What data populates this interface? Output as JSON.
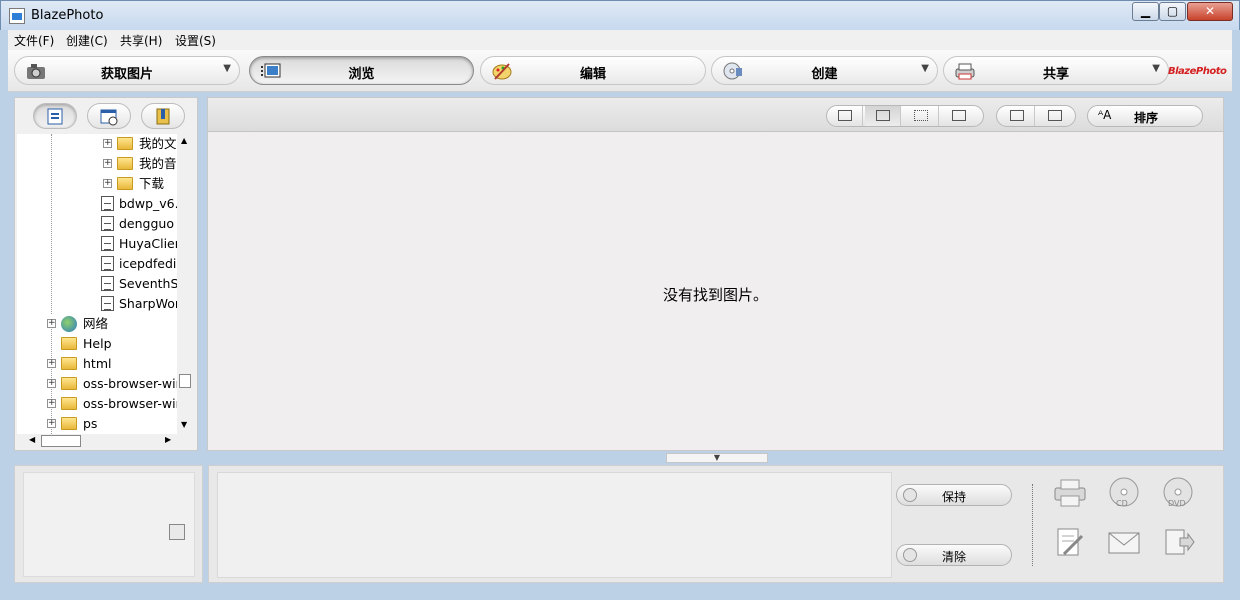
{
  "window": {
    "title": "BlazePhoto",
    "min_label": "0",
    "max_label": "1",
    "close_label": "r"
  },
  "menu": [
    "文件(F)",
    "创建(C)",
    "共享(H)",
    "设置(S)"
  ],
  "toolbar": {
    "acquire": "获取图片",
    "browse": "浏览",
    "edit": "编辑",
    "create": "创建",
    "share": "共享",
    "brand": "BlazePhoto"
  },
  "tree": {
    "items": [
      "我的文",
      "我的音",
      "下载",
      "bdwp_v6.",
      "dengguo",
      "HuyaClien",
      "icepdfedi",
      "SeventhS",
      "SharpWor",
      "网络",
      "Help",
      "html",
      "oss-browser-wir",
      "oss-browser-wir",
      "ps"
    ]
  },
  "main": {
    "sort_label": "排序",
    "empty_message": "没有找到图片。"
  },
  "bottom": {
    "keep_label": "保持",
    "clear_label": "清除"
  },
  "colors": {
    "accent": "#c7d9ee",
    "brand": "#d42020"
  }
}
